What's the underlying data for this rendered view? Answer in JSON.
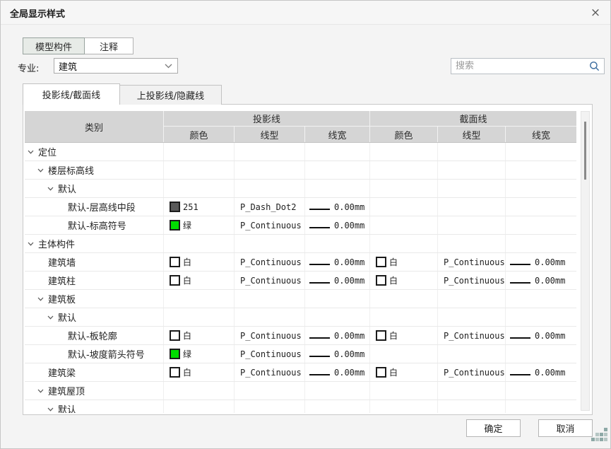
{
  "dialog": {
    "title": "全局显示样式",
    "close_icon": "×"
  },
  "mode_tabs": [
    {
      "label": "模型构件",
      "active": true
    },
    {
      "label": "注释",
      "active": false
    }
  ],
  "profession": {
    "label": "专业:",
    "value": "建筑"
  },
  "search": {
    "placeholder": "搜索",
    "icon": "magnifier"
  },
  "line_tabs": [
    {
      "label": "投影线/截面线",
      "active": true
    },
    {
      "label": "上投影线/隐藏线",
      "active": false
    }
  ],
  "table": {
    "category_header": "类别",
    "groups": [
      {
        "label": "投影线",
        "columns": [
          "颜色",
          "线型",
          "线宽"
        ]
      },
      {
        "label": "截面线",
        "columns": [
          "颜色",
          "线型",
          "线宽"
        ]
      }
    ],
    "rows": [
      {
        "label": "定位",
        "level": 0,
        "expandable": true
      },
      {
        "label": "楼层标高线",
        "level": 1,
        "expandable": true
      },
      {
        "label": "默认",
        "level": 2,
        "expandable": true
      },
      {
        "label": "默认-层高线中段",
        "level": 3,
        "expandable": false,
        "proj": {
          "color": {
            "hex": "#595959",
            "label": "251"
          },
          "linetype": "P_Dash_Dot2",
          "linewidth": "0.00mm"
        }
      },
      {
        "label": "默认-标高符号",
        "level": 3,
        "expandable": false,
        "proj": {
          "color": {
            "hex": "#00dd00",
            "label": "绿"
          },
          "linetype": "P_Continuous",
          "linewidth": "0.00mm"
        }
      },
      {
        "label": "主体构件",
        "level": 0,
        "expandable": true
      },
      {
        "label": "建筑墙",
        "level": 1,
        "expandable": false,
        "proj": {
          "color": {
            "hex": "#ffffff",
            "label": "白"
          },
          "linetype": "P_Continuous",
          "linewidth": "0.00mm"
        },
        "sect": {
          "color": {
            "hex": "#ffffff",
            "label": "白"
          },
          "linetype": "P_Continuous",
          "linewidth": "0.00mm"
        }
      },
      {
        "label": "建筑柱",
        "level": 1,
        "expandable": false,
        "proj": {
          "color": {
            "hex": "#ffffff",
            "label": "白"
          },
          "linetype": "P_Continuous",
          "linewidth": "0.00mm"
        },
        "sect": {
          "color": {
            "hex": "#ffffff",
            "label": "白"
          },
          "linetype": "P_Continuous",
          "linewidth": "0.00mm"
        }
      },
      {
        "label": "建筑板",
        "level": 1,
        "expandable": true
      },
      {
        "label": "默认",
        "level": 2,
        "expandable": true
      },
      {
        "label": "默认-板轮廓",
        "level": 3,
        "expandable": false,
        "proj": {
          "color": {
            "hex": "#ffffff",
            "label": "白"
          },
          "linetype": "P_Continuous",
          "linewidth": "0.00mm"
        },
        "sect": {
          "color": {
            "hex": "#ffffff",
            "label": "白"
          },
          "linetype": "P_Continuous",
          "linewidth": "0.00mm"
        }
      },
      {
        "label": "默认-坡度箭头符号",
        "level": 3,
        "expandable": false,
        "proj": {
          "color": {
            "hex": "#00dd00",
            "label": "绿"
          },
          "linetype": "P_Continuous",
          "linewidth": "0.00mm"
        }
      },
      {
        "label": "建筑梁",
        "level": 1,
        "expandable": false,
        "proj": {
          "color": {
            "hex": "#ffffff",
            "label": "白"
          },
          "linetype": "P_Continuous",
          "linewidth": "0.00mm"
        },
        "sect": {
          "color": {
            "hex": "#ffffff",
            "label": "白"
          },
          "linetype": "P_Continuous",
          "linewidth": "0.00mm"
        }
      },
      {
        "label": "建筑屋顶",
        "level": 1,
        "expandable": true
      },
      {
        "label": "默认",
        "level": 2,
        "expandable": true
      }
    ]
  },
  "footer": {
    "ok_label": "确定",
    "cancel_label": "取消"
  },
  "colors": {
    "accent_green": "#00dd00",
    "swatch_gray": "#595959",
    "header_bg": "#d5d5d5",
    "active_tab_bg": "#e7ebe7",
    "search_icon_blue": "#3a6b9e"
  }
}
